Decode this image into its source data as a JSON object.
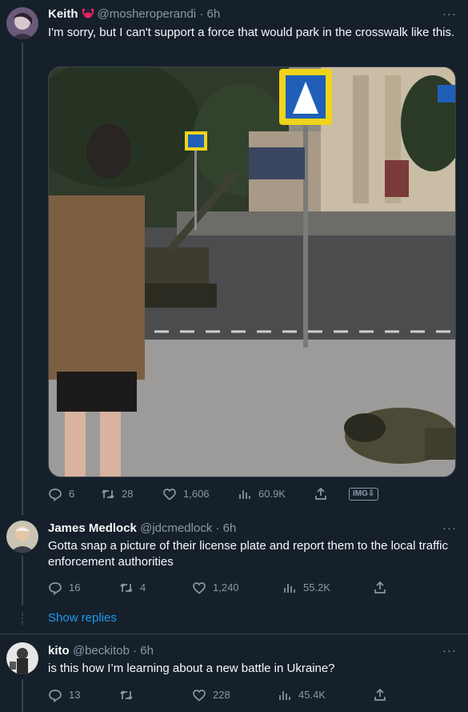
{
  "tweets": [
    {
      "name": "Keith",
      "handle": "@mosheroperandi",
      "time": "6h",
      "text": "I'm sorry, but I can't support a force that would park in the crosswalk like this.",
      "replies": "6",
      "retweets": "28",
      "likes": "1,606",
      "views": "60.9K",
      "img_badge": "IMG⇩"
    },
    {
      "name": "James Medlock",
      "handle": "@jdcmedlock",
      "time": "6h",
      "text": "Gotta snap a picture of their license plate and report them to the local traffic enforcement authorities",
      "replies": "16",
      "retweets": "4",
      "likes": "1,240",
      "views": "55.2K"
    },
    {
      "name": "kito",
      "handle": "@beckitob",
      "time": "6h",
      "text": "is this how I’m learning about a new battle in Ukraine?",
      "replies": "13",
      "retweets": "",
      "likes": "228",
      "views": "45.4K"
    }
  ],
  "show_replies": "Show replies",
  "separator": "·",
  "more_label": "···",
  "colors": {
    "background": "#15202b",
    "accent": "#1d9bf0",
    "muted": "#8b98a5",
    "border": "#38444d"
  }
}
